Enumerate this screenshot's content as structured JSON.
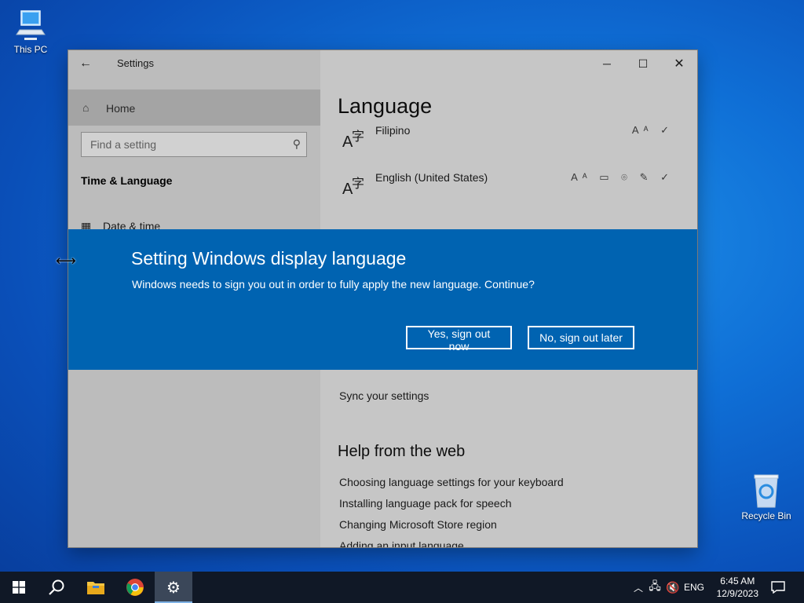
{
  "desktop": {
    "icons": [
      {
        "label": "This PC"
      },
      {
        "label": "Recycle Bin"
      }
    ]
  },
  "window": {
    "title": "Settings",
    "sidebar": {
      "home_label": "Home",
      "search_placeholder": "Find a setting",
      "section_title": "Time & Language",
      "nav_item": "Date & time"
    },
    "content": {
      "page_title": "Language",
      "languages": [
        {
          "name": "Filipino",
          "glyph_big": "A",
          "glyph_small": "字"
        },
        {
          "name": "English (United States)",
          "glyph_big": "A",
          "glyph_small": "字"
        }
      ],
      "sync_link": "Sync your settings",
      "help_heading": "Help from the web",
      "help_links": [
        "Choosing language settings for your keyboard",
        "Installing language pack for speech",
        "Changing Microsoft Store region",
        "Adding an input language"
      ]
    }
  },
  "dialog": {
    "heading": "Setting Windows display language",
    "message": "Windows needs to sign you out in order to fully apply the new language. Continue?",
    "yes_label": "Yes, sign out now",
    "no_label": "No, sign out later",
    "accent": "#0063b1"
  },
  "taskbar": {
    "language": "ENG",
    "time": "6:45 AM",
    "date": "12/9/2023"
  }
}
